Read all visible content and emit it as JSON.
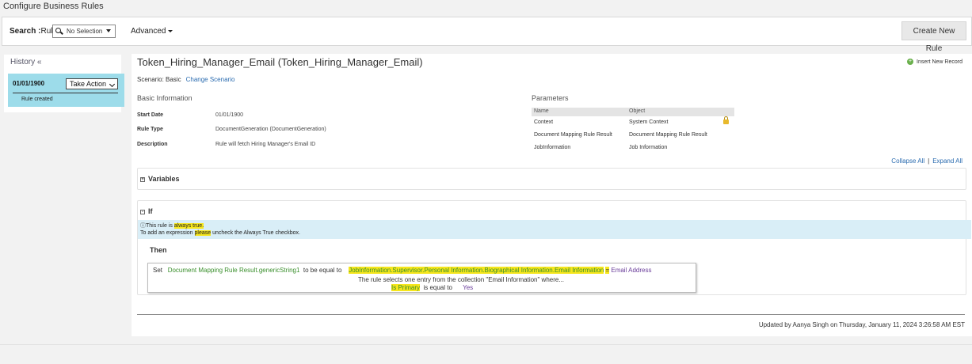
{
  "app": {
    "title": "Configure Business Rules"
  },
  "search": {
    "label": "Search :",
    "type_label": "Rule",
    "selected": "No Selection",
    "advanced_label": "Advanced",
    "create_button": "Create New Rule"
  },
  "history": {
    "title": "History «",
    "entry": {
      "date": "01/01/1900",
      "action_label": "Take Action",
      "status": "Rule created"
    }
  },
  "rule": {
    "title": "Token_Hiring_Manager_Email (Token_Hiring_Manager_Email)",
    "insert_record": "Insert New Record",
    "scenario_label": "Scenario: Basic",
    "change_scenario": "Change Scenario"
  },
  "basic_info": {
    "heading": "Basic Information",
    "fields": [
      {
        "label": "Start Date",
        "value": "01/01/1900"
      },
      {
        "label": "Rule Type",
        "value": "DocumentGeneration (DocumentGeneration)"
      },
      {
        "label": "Description",
        "value": "Rule will fetch Hiring Manager's Email ID"
      }
    ]
  },
  "parameters": {
    "heading": "Parameters",
    "columns": [
      "Name",
      "Object"
    ],
    "rows": [
      {
        "name": "Context",
        "object": "System Context",
        "locked": true
      },
      {
        "name": "Document Mapping Rule Result",
        "object": "Document Mapping Rule Result",
        "locked": false
      },
      {
        "name": "JobInformation",
        "object": "Job Information",
        "locked": false
      }
    ]
  },
  "controls": {
    "collapse_all": "Collapse All",
    "separator": "|",
    "expand_all": "Expand All"
  },
  "variables": {
    "toggle": "+",
    "title": "Variables"
  },
  "if_section": {
    "toggle": "-",
    "title": "If",
    "notice": {
      "icon": "ⓘ",
      "part1": "This rule is ",
      "part2": "always true.",
      "line2a": "To add an expression ",
      "line2b": "please",
      "line2c": " uncheck the Always True checkbox."
    }
  },
  "then_section": {
    "title": "Then",
    "set_kw": "Set",
    "target": "Document Mapping Rule Result.genericString1",
    "equal_kw": "to be equal to",
    "source": "JobInformation.Supervisor.Personal Information.Biographical Information.Email Information",
    "op": "=",
    "source_field": "Email Address",
    "collection_note": "The rule selects one entry from the collection \"Email Information\" where...",
    "cond_field": "Is Primary",
    "cond_op": "is equal to",
    "cond_value": "Yes"
  },
  "footer": {
    "updated": "Updated by Aanya Singh on Thursday, January 11, 2024 3:26:58 AM EST"
  }
}
